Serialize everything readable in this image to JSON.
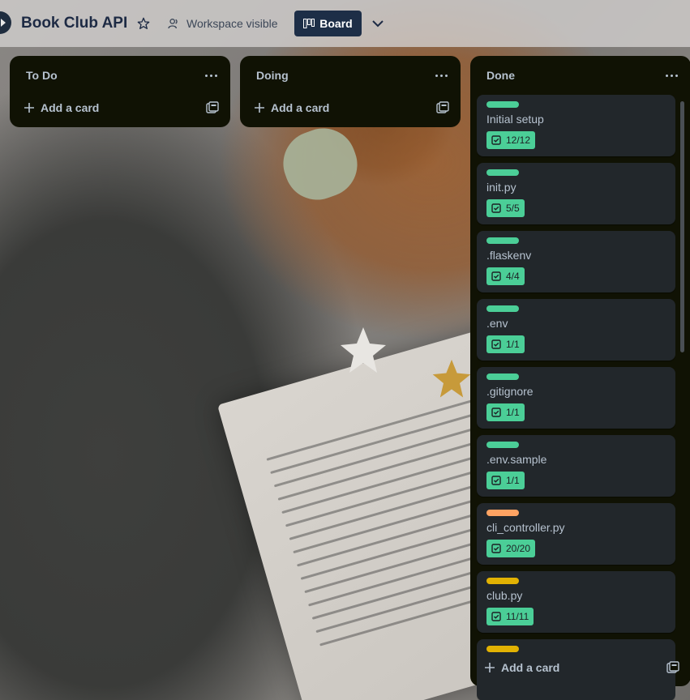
{
  "header": {
    "board_title": "Book Club API",
    "visibility_label": "Workspace visible",
    "view_label": "Board"
  },
  "lists": [
    {
      "title": "To Do",
      "add_card_label": "Add a card"
    },
    {
      "title": "Doing",
      "add_card_label": "Add a card"
    },
    {
      "title": "Done",
      "add_card_label": "Add a card",
      "cards": [
        {
          "title": "Initial setup",
          "checklist": "12/12",
          "label_color": "#4bce97"
        },
        {
          "title": "init.py",
          "checklist": "5/5",
          "label_color": "#4bce97"
        },
        {
          "title": ".flaskenv",
          "checklist": "4/4",
          "label_color": "#4bce97"
        },
        {
          "title": ".env",
          "checklist": "1/1",
          "label_color": "#4bce97"
        },
        {
          "title": ".gitignore",
          "checklist": "1/1",
          "label_color": "#4bce97"
        },
        {
          "title": ".env.sample",
          "checklist": "1/1",
          "label_color": "#4bce97"
        },
        {
          "title": "cli_controller.py",
          "checklist": "20/20",
          "label_color": "#fea362"
        },
        {
          "title": "club.py",
          "checklist": "11/11",
          "label_color": "#e2b203"
        },
        {
          "title": "",
          "checklist": "",
          "label_color": "#e2b203"
        }
      ]
    }
  ],
  "colors": {
    "list_bg": "#101204",
    "card_bg": "#22272b",
    "badge_green": "#4bce97",
    "view_button_bg": "#1d2e47"
  },
  "icons": {
    "star": "star-icon",
    "visibility": "people-icon",
    "board": "board-icon",
    "chevron": "chevron-down-icon",
    "menu": "more-icon",
    "add": "plus-icon",
    "template": "card-template-icon",
    "checklist": "checkbox-icon"
  }
}
